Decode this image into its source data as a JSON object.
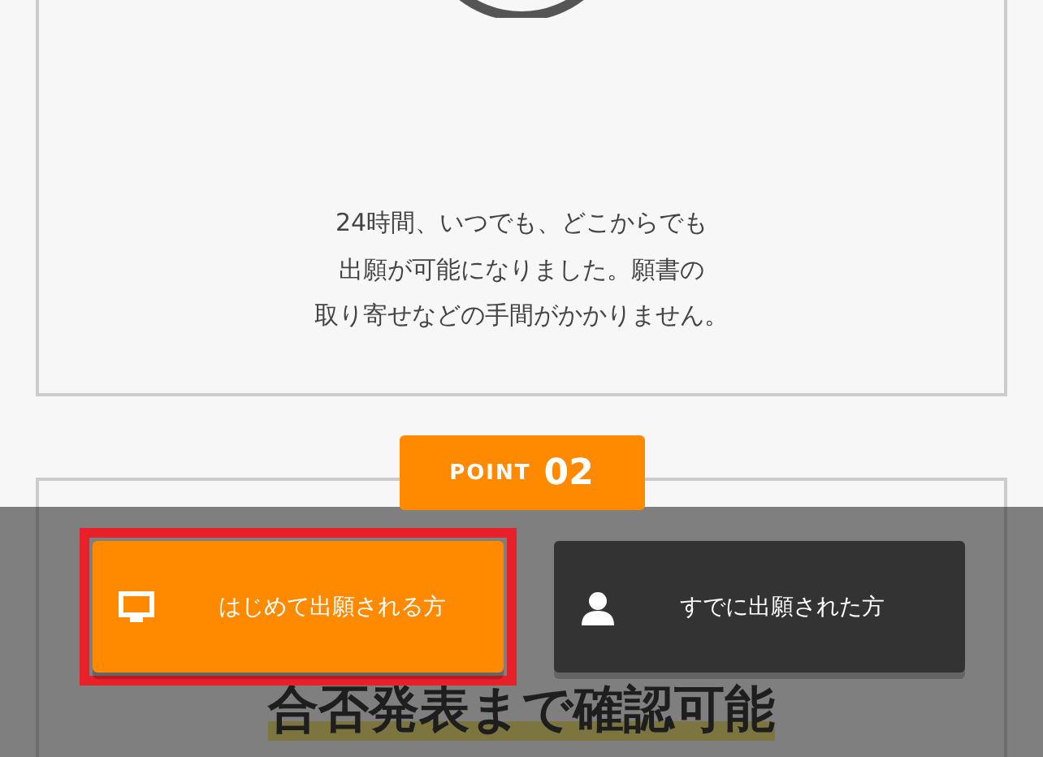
{
  "point1": {
    "text_lines": [
      "24時間、いつでも、どこからでも",
      "出願が可能になりました。願書の",
      "取り寄せなどの手間がかかりません。"
    ]
  },
  "point2": {
    "badge_word": "POINT",
    "badge_number": "02",
    "title": "合否発表まで確認可能"
  },
  "bottom_bar": {
    "buttons": [
      {
        "kind": "monitor",
        "label": "はじめて出願される方",
        "highlighted": true
      },
      {
        "kind": "person",
        "label": "すでに出願された方",
        "highlighted": false
      }
    ]
  }
}
